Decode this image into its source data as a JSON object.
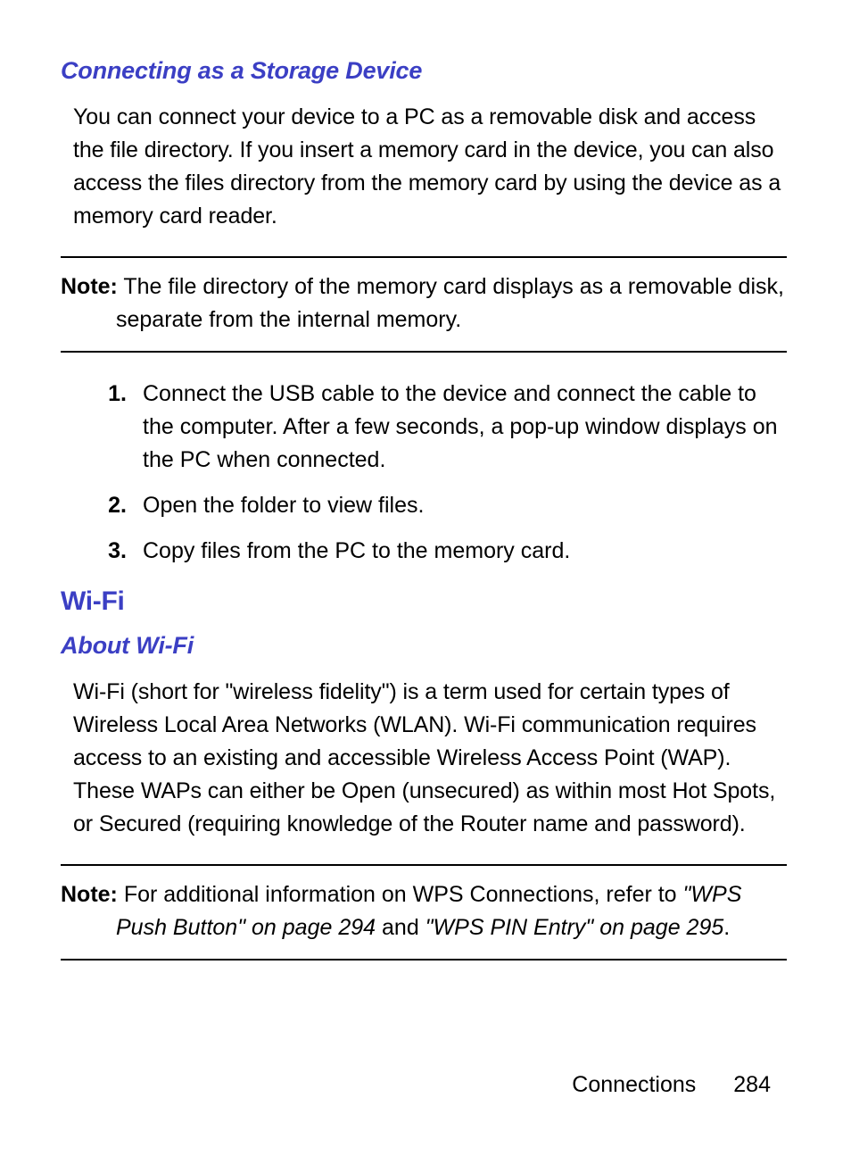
{
  "storage": {
    "heading": "Connecting as a Storage Device",
    "para": "You can connect your device to a PC as a removable disk and access the file directory. If you insert a memory card in the device, you can also access the files directory from the memory card by using the device as a memory card reader.",
    "note_label": "Note:",
    "note_text": " The file directory of the memory card displays as a removable disk, separate from the internal memory.",
    "steps": [
      {
        "num": "1.",
        "text": "Connect the USB cable to the device and connect the cable to the computer. After a few seconds, a pop-up window displays on the PC when connected."
      },
      {
        "num": "2.",
        "text": "Open the folder to view files."
      },
      {
        "num": "3.",
        "text": "Copy files from the PC to the memory card."
      }
    ]
  },
  "wifi": {
    "section_heading": "Wi-Fi",
    "sub_heading": "About Wi-Fi",
    "para": "Wi-Fi (short for \"wireless fidelity\") is a term used for certain types of Wireless Local Area Networks (WLAN). Wi-Fi communication requires access to an existing and accessible Wireless Access Point (WAP). These WAPs can either be Open (unsecured) as within most Hot Spots, or Secured (requiring knowledge of the Router name and password).",
    "note_label": "Note:",
    "note_text_a": " For additional information on WPS Connections, refer to ",
    "note_ref1": "\"WPS Push Button\" on page 294",
    "note_text_b": " and ",
    "note_ref2": "\"WPS PIN Entry\" on page 295",
    "note_text_c": "."
  },
  "footer": {
    "section": "Connections",
    "page": "284"
  }
}
